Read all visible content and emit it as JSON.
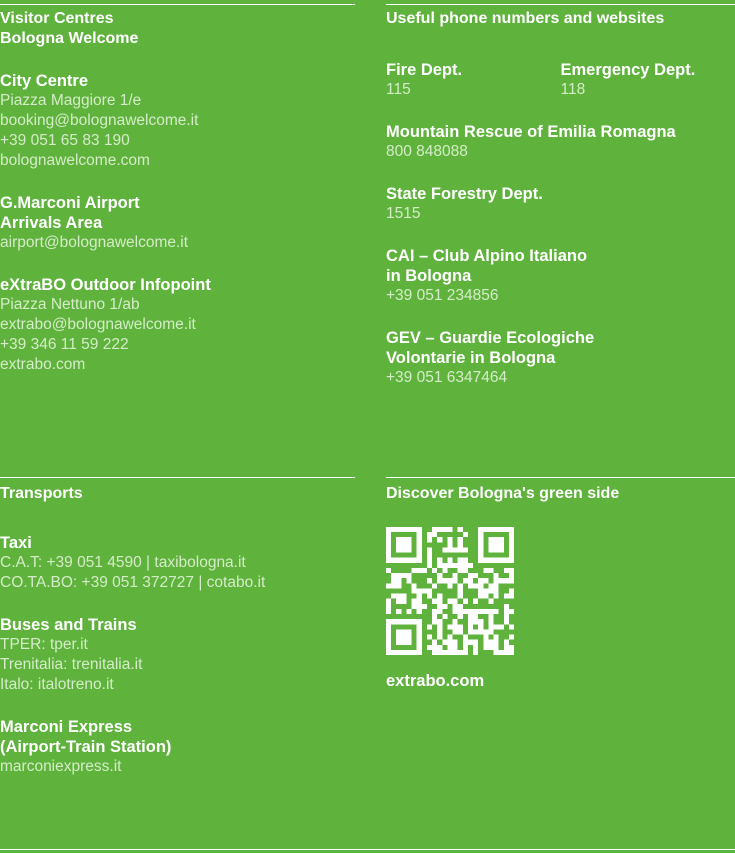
{
  "left_top": {
    "title_lines": [
      "Visitor Centres",
      "Bologna Welcome"
    ],
    "blocks": [
      {
        "head": [
          "City Centre"
        ],
        "lines": [
          "Piazza Maggiore 1/e",
          "booking@bolognawelcome.it",
          "+39 051 65 83 190",
          "bolognawelcome.com"
        ]
      },
      {
        "head": [
          "G.Marconi Airport",
          "Arrivals Area"
        ],
        "lines": [
          "airport@bolognawelcome.it"
        ]
      },
      {
        "head": [
          "eXtraBO Outdoor Infopoint"
        ],
        "lines": [
          "Piazza Nettuno 1/ab",
          "extrabo@bolognawelcome.it",
          "+39 346 11 59 222",
          "extrabo.com"
        ]
      }
    ]
  },
  "right_top": {
    "title": "Useful phone numbers and websites",
    "fire": {
      "head": "Fire Dept.",
      "value": "115"
    },
    "emergency": {
      "head": "Emergency Dept.",
      "value": "118"
    },
    "blocks": [
      {
        "head": [
          "Mountain Rescue of Emilia Romagna"
        ],
        "lines": [
          "800 848088"
        ]
      },
      {
        "head": [
          "State Forestry Dept."
        ],
        "lines": [
          "1515"
        ]
      },
      {
        "head": [
          "CAI – Club Alpino Italiano",
          "in Bologna"
        ],
        "lines": [
          "+39 051 234856"
        ]
      },
      {
        "head": [
          "GEV – Guardie Ecologiche",
          "Volontarie in Bologna"
        ],
        "lines": [
          "+39 051 6347464"
        ]
      }
    ]
  },
  "left_bottom": {
    "title": "Transports",
    "blocks": [
      {
        "head": [
          "Taxi"
        ],
        "lines": [
          "C.A.T: +39 051 4590 | taxibologna.it",
          "CO.TA.BO: +39 051 372727 | cotabo.it"
        ]
      },
      {
        "head": [
          "Buses and Trains"
        ],
        "lines": [
          "TPER: tper.it",
          "Trenitalia: trenitalia.it",
          "Italo: italotreno.it"
        ]
      },
      {
        "head": [
          "Marconi Express",
          "(Airport-Train Station)"
        ],
        "lines": [
          "marconiexpress.it"
        ]
      }
    ]
  },
  "right_bottom": {
    "title": "Discover Bologna's green side",
    "qr_icon": "qr-code-icon",
    "link": "extrabo.com"
  }
}
